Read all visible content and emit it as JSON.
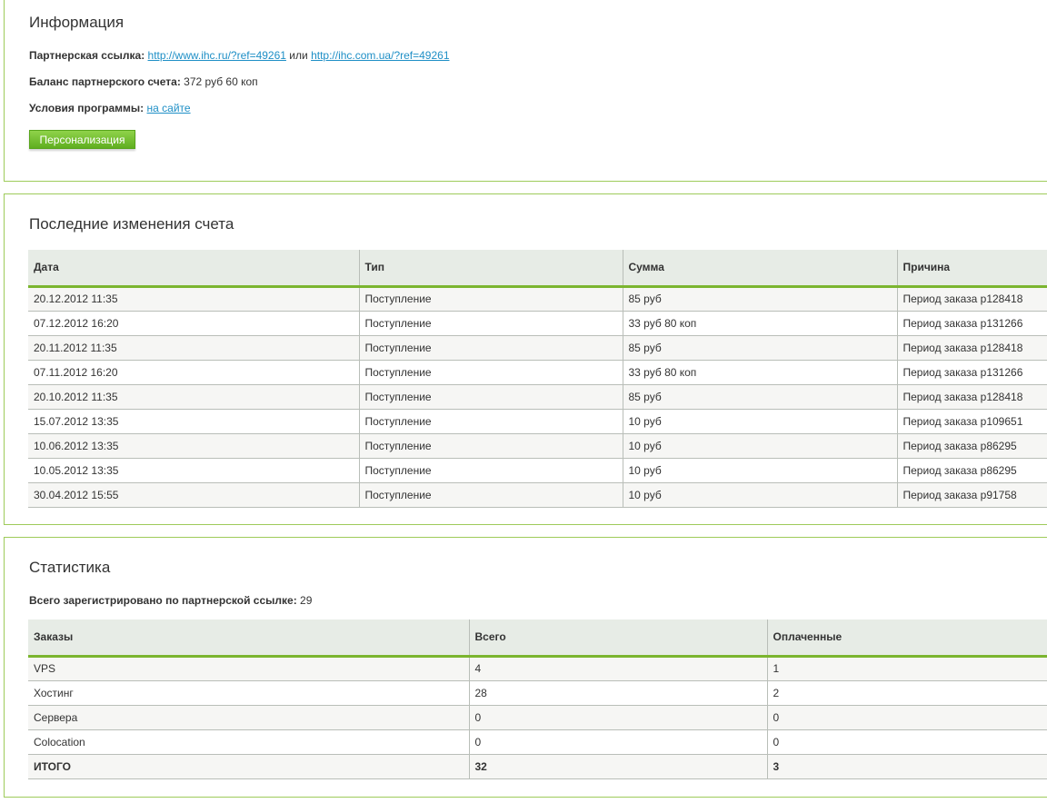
{
  "info": {
    "title": "Информация",
    "ref_label": "Партнерская ссылка:",
    "ref_link_1": "http://www.ihc.ru/?ref=49261",
    "ref_or": "или",
    "ref_link_2": "http://ihc.com.ua/?ref=49261",
    "balance_label": "Баланс партнерского счета:",
    "balance_value": "372 руб 60 коп",
    "terms_label": "Условия программы:",
    "terms_link": "на сайте",
    "personalize_button": "Персонализация"
  },
  "changes": {
    "title": "Последние изменения счета",
    "columns": [
      "Дата",
      "Тип",
      "Сумма",
      "Причина"
    ],
    "rows": [
      [
        "20.12.2012 11:35",
        "Поступление",
        "85 руб",
        "Период заказа p128418"
      ],
      [
        "07.12.2012 16:20",
        "Поступление",
        "33 руб 80 коп",
        "Период заказа p131266"
      ],
      [
        "20.11.2012 11:35",
        "Поступление",
        "85 руб",
        "Период заказа p128418"
      ],
      [
        "07.11.2012 16:20",
        "Поступление",
        "33 руб 80 коп",
        "Период заказа p131266"
      ],
      [
        "20.10.2012 11:35",
        "Поступление",
        "85 руб",
        "Период заказа p128418"
      ],
      [
        "15.07.2012 13:35",
        "Поступление",
        "10 руб",
        "Период заказа p109651"
      ],
      [
        "10.06.2012 13:35",
        "Поступление",
        "10 руб",
        "Период заказа p86295"
      ],
      [
        "10.05.2012 13:35",
        "Поступление",
        "10 руб",
        "Период заказа p86295"
      ],
      [
        "30.04.2012 15:55",
        "Поступление",
        "10 руб",
        "Период заказа p91758"
      ]
    ]
  },
  "stats": {
    "title": "Статистика",
    "registered_label": "Всего зарегистрировано по партнерской ссылке:",
    "registered_value": "29",
    "columns": [
      "Заказы",
      "Всего",
      "Оплаченные"
    ],
    "rows": [
      [
        "VPS",
        "4",
        "1"
      ],
      [
        "Хостинг",
        "28",
        "2"
      ],
      [
        "Сервера",
        "0",
        "0"
      ],
      [
        "Colocation",
        "0",
        "0"
      ],
      [
        "ИТОГО",
        "32",
        "3"
      ]
    ]
  },
  "colors": {
    "accent_green": "#7bb52f",
    "panel_border": "#9ecb5a",
    "link": "#1e8fc6"
  }
}
